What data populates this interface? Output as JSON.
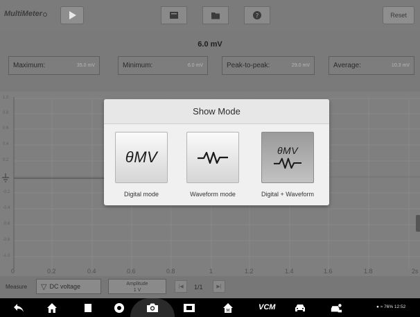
{
  "app": {
    "title": "MultiMeter"
  },
  "toolbar": {
    "reset_label": "Reset"
  },
  "readout": {
    "value": "6.0 mV",
    "stats": [
      {
        "label": "Maximum:",
        "value": "35.0 mV"
      },
      {
        "label": "Minimum:",
        "value": "6.0 mV"
      },
      {
        "label": "Peak-to-peak:",
        "value": "29.0 mV"
      },
      {
        "label": "Average:",
        "value": "10.3 mV"
      }
    ]
  },
  "graph": {
    "y_ticks": [
      "1.0",
      "0.8",
      "0.6",
      "0.4",
      "0.2",
      "0",
      "-0.2",
      "-0.4",
      "-0.6",
      "-0.8",
      "-1.0"
    ],
    "x_ticks": [
      "0",
      "0.2",
      "0.4",
      "0.6",
      "0.8",
      "1",
      "1.2",
      "1.4",
      "1.6",
      "1.8",
      "2s"
    ]
  },
  "measure": {
    "label": "Measure",
    "selected": "DC voltage",
    "amplitude_label": "Amplitude",
    "amplitude_value": "1 V",
    "page": "1/1"
  },
  "modal": {
    "title": "Show Mode",
    "digital_glyph": "θMV",
    "options": [
      {
        "label": "Digital mode",
        "icon": "digital-icon"
      },
      {
        "label": "Waveform mode",
        "icon": "waveform-icon"
      },
      {
        "label": "Digital + Waveform",
        "icon": "digital-waveform-icon",
        "selected": true
      }
    ]
  },
  "navbar": {
    "vcm_label": "VCM",
    "status": "76% 12:52"
  }
}
